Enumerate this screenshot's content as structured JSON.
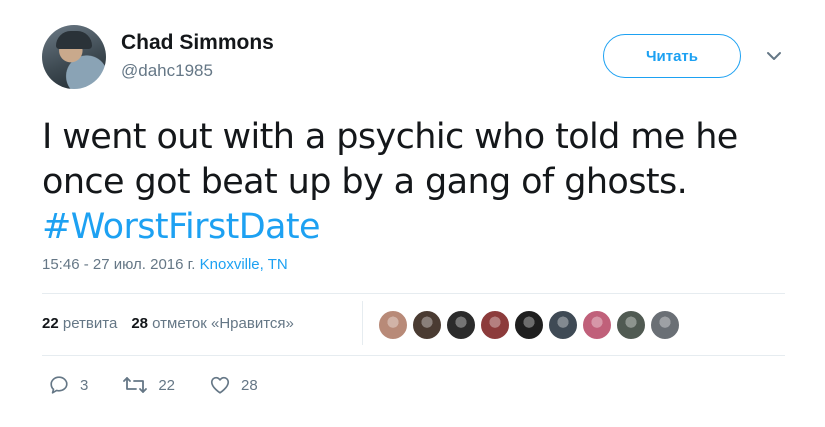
{
  "user": {
    "name": "Chad Simmons",
    "handle": "@dahc1985"
  },
  "follow_button": {
    "label": "Читать"
  },
  "tweet": {
    "lines": [
      "I went out with a psychic who told me he",
      "once got beat up by a gang of ghosts."
    ],
    "hashtag": "#WorstFirstDate"
  },
  "meta": {
    "timestamp": "15:46 - 27 июл. 2016 г.",
    "location": "Knoxville, TN"
  },
  "stats": {
    "retweets_count": "22",
    "retweets_label": "ретвита",
    "likes_count": "28",
    "likes_label": "отметок «Нравится»"
  },
  "likers": [
    {
      "color": "#b88a78"
    },
    {
      "color": "#4a3b32"
    },
    {
      "color": "#2b2b2b"
    },
    {
      "color": "#8c3b3b"
    },
    {
      "color": "#1f1f1f"
    },
    {
      "color": "#3f4a55"
    },
    {
      "color": "#c0607a"
    },
    {
      "color": "#505a52"
    },
    {
      "color": "#6a6f75"
    }
  ],
  "actions": {
    "reply_count": "3",
    "retweet_count": "22",
    "like_count": "28"
  },
  "colors": {
    "accent": "#1da1f2",
    "text": "#14171a",
    "secondary": "#657786",
    "divider": "#e6ecf0"
  }
}
